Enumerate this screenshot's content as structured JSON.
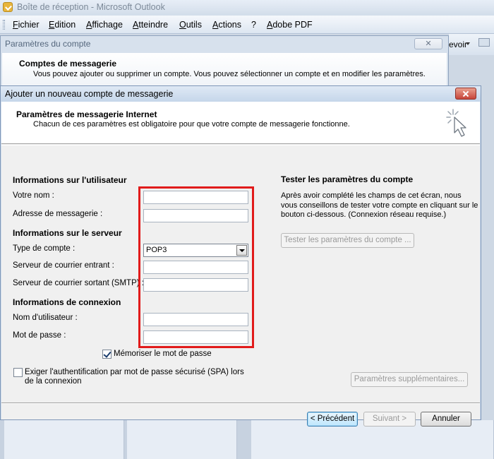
{
  "outlook": {
    "title": "Boîte de réception - Microsoft Outlook",
    "menu": [
      "Fichier",
      "Edition",
      "Affichage",
      "Atteindre",
      "Outils",
      "Actions",
      "?",
      "Adobe PDF"
    ],
    "send_receive_fragment": "evoir"
  },
  "account_settings": {
    "title": "Paramètres du compte",
    "heading": "Comptes de messagerie",
    "description": "Vous pouvez ajouter ou supprimer un compte. Vous pouvez sélectionner un compte et en modifier les paramètres."
  },
  "dialog": {
    "title": "Ajouter un nouveau compte de messagerie",
    "header_title": "Paramètres de messagerie Internet",
    "header_desc": "Chacun de ces paramètres est obligatoire pour que votre compte de messagerie fonctionne."
  },
  "user_info": {
    "heading": "Informations sur l'utilisateur",
    "name_label": "Votre nom :",
    "name_value": "",
    "email_label": "Adresse de messagerie :",
    "email_value": ""
  },
  "server_info": {
    "heading": "Informations sur le serveur",
    "account_type_label": "Type de compte :",
    "account_type_value": "POP3",
    "incoming_label": "Serveur de courrier entrant :",
    "incoming_value": "",
    "outgoing_label": "Serveur de courrier sortant (SMTP) :",
    "outgoing_value": ""
  },
  "login_info": {
    "heading": "Informations de connexion",
    "username_label": "Nom d'utilisateur :",
    "username_value": "",
    "password_label": "Mot de passe :",
    "password_value": "",
    "remember_label": "Mémoriser le mot de passe",
    "remember_checked": true,
    "spa_label_line1": "Exiger l'authentification par mot de passe sécurisé (SPA) lors",
    "spa_label_line2": "de la connexion",
    "spa_checked": false
  },
  "test_settings": {
    "heading": "Tester les paramètres du compte",
    "description": "Après avoir complété les champs de cet écran, nous vous conseillons de tester votre compte en cliquant sur le bouton ci-dessous. (Connexion réseau requise.)",
    "test_button": "Tester les paramètres du compte ...",
    "more_settings_button": "Paramètres supplémentaires..."
  },
  "footer": {
    "back_button": "< Précédent",
    "next_button": "Suivant >",
    "cancel_button": "Annuler"
  },
  "colors": {
    "highlight": "#e11b1b",
    "dialog_bg": "#f0f0f0",
    "title_bar": "#cfdcec"
  }
}
